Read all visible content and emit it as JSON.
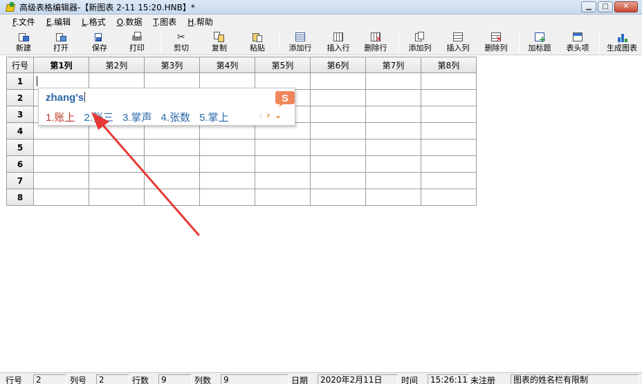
{
  "window": {
    "title": "高级表格编辑器-【新图表 2-11 15:20.HNB】*",
    "minimize": "▁",
    "maximize": "□",
    "close": "✕"
  },
  "menu": [
    {
      "key": "F",
      "label": ".文件"
    },
    {
      "key": "E",
      "label": ".编辑"
    },
    {
      "key": "L",
      "label": ".格式"
    },
    {
      "key": "O",
      "label": ".数据"
    },
    {
      "key": "T",
      "label": ".图表"
    },
    {
      "key": "H",
      "label": ".帮助"
    }
  ],
  "toolbar": {
    "new": "新建",
    "open": "打开",
    "save": "保存",
    "print": "打印",
    "cut": "剪切",
    "copy": "复制",
    "paste": "粘贴",
    "add_row": "添加行",
    "insert_row": "插入行",
    "delete_row": "删除行",
    "add_col": "添加列",
    "insert_col": "插入列",
    "delete_col": "删除列",
    "add_title": "加标题",
    "header_item": "表头项",
    "make_chart": "生成图表"
  },
  "grid": {
    "corner": "行号",
    "columns": [
      "第1列",
      "第2列",
      "第3列",
      "第4列",
      "第5列",
      "第6列",
      "第7列",
      "第8列"
    ],
    "rows": [
      "1",
      "2",
      "3",
      "4",
      "5",
      "6",
      "7",
      "8"
    ]
  },
  "ime": {
    "input": "zhang's",
    "candidates": [
      "1.账上",
      "2.张三",
      "3.掌声",
      "4.张数",
      "5.掌上"
    ],
    "prev": "‹",
    "next": "›",
    "more": "⌄",
    "logo_letter": "S"
  },
  "status": {
    "row_label": "行号",
    "row_value": "2",
    "col_label": "列号",
    "col_value": "2",
    "rows_label": "行数",
    "rows_value": "9",
    "cols_label": "列数",
    "cols_value": "9",
    "date_label": "日期",
    "date_value": "2020年2月11日",
    "time_label": "时间",
    "time_value": "15:26:11",
    "reg": "未注册",
    "message": "图表的姓名栏有限制"
  },
  "colors": {
    "ime_text": "#2a67a8",
    "ime_first": "#c0392b",
    "arrow": "#e53935",
    "sogou_logo": "#f0855a"
  }
}
